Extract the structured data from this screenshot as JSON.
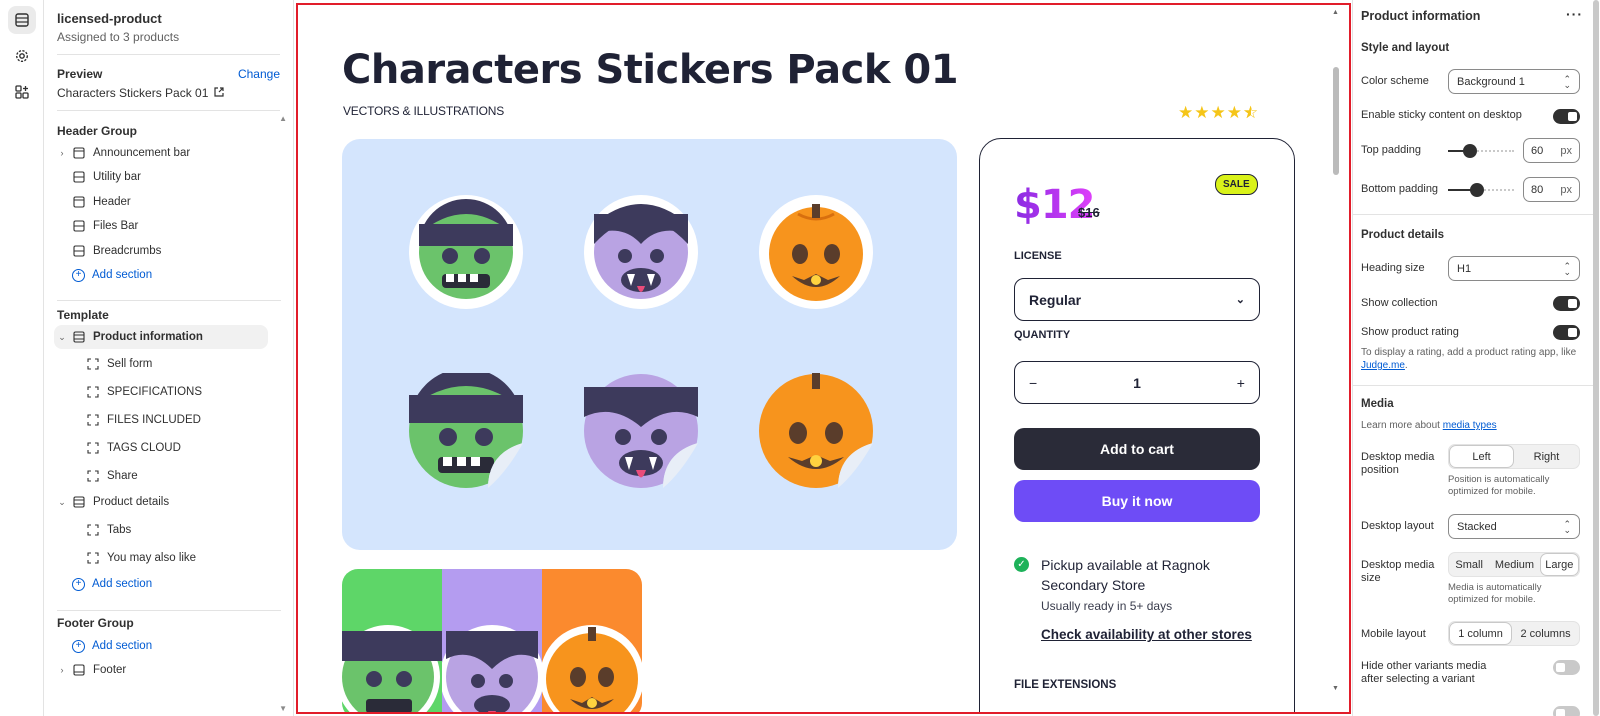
{
  "sidebar": {
    "template_name": "licensed-product",
    "assigned": "Assigned to 3 products",
    "preview_label": "Preview",
    "change_label": "Change",
    "preview_product": "Characters Stickers Pack 01",
    "header_group": {
      "title": "Header Group",
      "items": [
        "Announcement bar",
        "Utility bar",
        "Header",
        "Files Bar",
        "Breadcrumbs"
      ],
      "add_label": "Add section"
    },
    "template": {
      "title": "Template",
      "product_information": "Product information",
      "blocks": [
        "Sell form",
        "SPECIFICATIONS",
        "FILES INCLUDED",
        "TAGS CLOUD",
        "Share"
      ],
      "product_details": "Product details",
      "details_blocks": [
        "Tabs",
        "You may also like"
      ],
      "add_label": "Add section"
    },
    "footer_group": {
      "title": "Footer Group",
      "add_label": "Add section",
      "footer": "Footer"
    }
  },
  "preview": {
    "product_title": "Characters Stickers Pack 01",
    "collection": "VECTORS & ILLUSTRATIONS",
    "rating": 4.5,
    "price": "$12",
    "compare_price": "$16",
    "sale_badge": "SALE",
    "license_label": "LICENSE",
    "license_value": "Regular",
    "quantity_label": "QUANTITY",
    "quantity_value": "1",
    "minus": "−",
    "plus": "+",
    "add_to_cart": "Add to cart",
    "buy_now": "Buy it now",
    "pickup_text": "Pickup available at Ragnok Secondary Store",
    "pickup_sub": "Usually ready in 5+ days",
    "check_stores": "Check availability at other stores",
    "file_extensions": "FILE EXTENSIONS",
    "colors": {
      "title": "#1f2235",
      "media_bg": "#d4e5fd",
      "cart_btn": "#2a2b38",
      "buy_btn": "#6e4cf6",
      "sale_badge": "#d9f21a",
      "frame_border": "#e11d2a"
    }
  },
  "settings": {
    "title": "Product information",
    "more": "···",
    "style_layout": "Style and layout",
    "color_scheme_label": "Color scheme",
    "color_scheme_value": "Background 1",
    "sticky_label": "Enable sticky content on desktop",
    "sticky_on": true,
    "top_padding_label": "Top padding",
    "top_padding_value": "60",
    "bottom_padding_label": "Bottom padding",
    "bottom_padding_value": "80",
    "unit": "px",
    "product_details": "Product details",
    "heading_size_label": "Heading size",
    "heading_size_value": "H1",
    "show_collection_label": "Show collection",
    "show_collection_on": true,
    "show_rating_label": "Show product rating",
    "show_rating_on": true,
    "rating_help": "To display a rating, add a product rating app, like",
    "rating_help_link": "Judge.me",
    "media": "Media",
    "media_learn": "Learn more about",
    "media_learn_link": "media types",
    "media_position_label": "Desktop media position",
    "media_position_options": [
      "Left",
      "Right"
    ],
    "media_position_selected": "Left",
    "media_position_help": "Position is automatically optimized for mobile.",
    "desktop_layout_label": "Desktop layout",
    "desktop_layout_value": "Stacked",
    "media_size_label": "Desktop media size",
    "media_size_options": [
      "Small",
      "Medium",
      "Large"
    ],
    "media_size_selected": "Large",
    "media_size_help": "Media is automatically optimized for mobile.",
    "mobile_layout_label": "Mobile layout",
    "mobile_layout_options": [
      "1 column",
      "2 columns"
    ],
    "mobile_layout_selected": "1 column",
    "hide_variants_label": "Hide other variants media after selecting a variant",
    "hide_variants_on": false
  }
}
